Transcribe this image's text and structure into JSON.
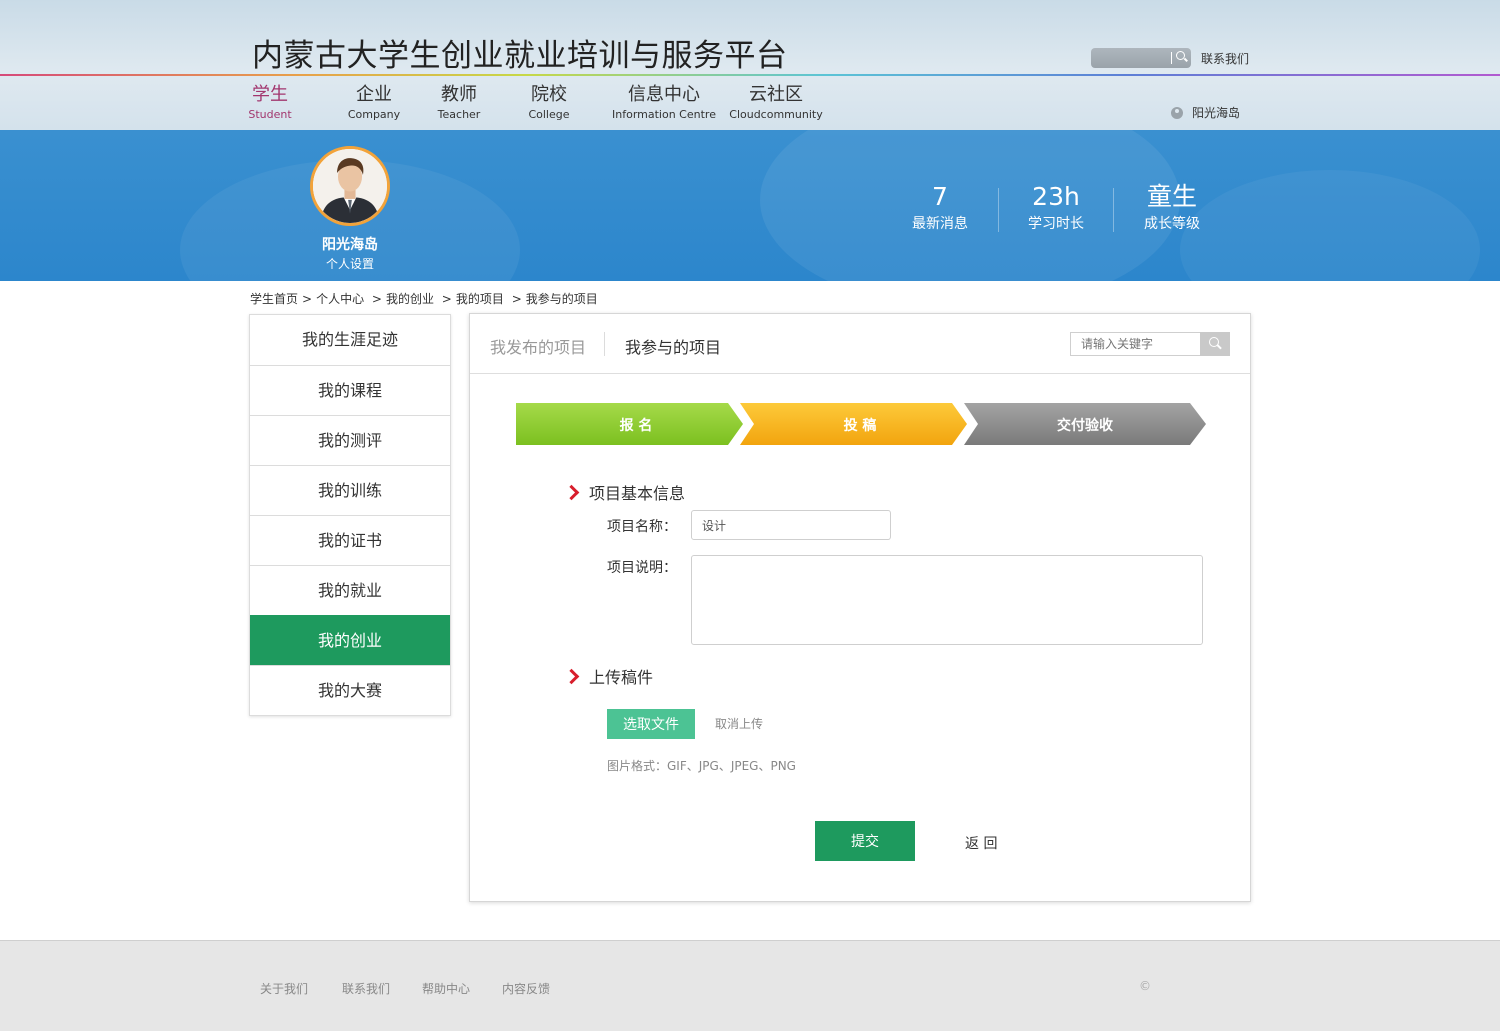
{
  "site": {
    "title": "内蒙古大学生创业就业培训与服务平台",
    "contact": "联系我们",
    "user": "阳光海岛"
  },
  "nav": [
    {
      "zh": "学生",
      "en": "Student",
      "active": true
    },
    {
      "zh": "企业",
      "en": "Company",
      "active": false
    },
    {
      "zh": "教师",
      "en": "Teacher",
      "active": false
    },
    {
      "zh": "院校",
      "en": "College",
      "active": false
    },
    {
      "zh": "信息中心",
      "en": "Information Centre",
      "active": false
    },
    {
      "zh": "云社区",
      "en": "Cloudcommunity",
      "active": false
    }
  ],
  "profile": {
    "name": "阳光海岛",
    "settings": "个人设置",
    "stats": [
      {
        "value": "7",
        "label": "最新消息"
      },
      {
        "value": "23h",
        "label": "学习时长"
      },
      {
        "value": "童生",
        "label": "成长等级"
      }
    ]
  },
  "breadcrumb": [
    "学生首页",
    "个人中心",
    "我的创业",
    "我的项目",
    "我参与的项目"
  ],
  "sidebar": [
    {
      "label": "我的生涯足迹",
      "active": false
    },
    {
      "label": "我的课程",
      "active": false
    },
    {
      "label": "我的测评",
      "active": false
    },
    {
      "label": "我的训练",
      "active": false
    },
    {
      "label": "我的证书",
      "active": false
    },
    {
      "label": "我的就业",
      "active": false
    },
    {
      "label": "我的创业",
      "active": true
    },
    {
      "label": "我的大赛",
      "active": false
    }
  ],
  "panel": {
    "tabs": [
      "我发布的项目",
      "我参与的项目"
    ],
    "active_tab": 1,
    "search_placeholder": "请输入关键字",
    "steps": [
      {
        "label": "报 名",
        "color": "#8ccc2e"
      },
      {
        "label": "投 稿",
        "color": "#f7b719"
      },
      {
        "label": "交付验收",
        "color": "#8d8d8d"
      }
    ],
    "section_info": "项目基本信息",
    "name_label": "项目名称：",
    "name_value": "设计",
    "desc_label": "项目说明：",
    "desc_value": "",
    "section_upload": "上传稿件",
    "choose_file": "选取文件",
    "cancel_upload": "取消上传",
    "formats": "图片格式：GIF、JPG、JPEG、PNG",
    "submit": "提交",
    "back": "返 回"
  },
  "footer": {
    "links": [
      "关于我们",
      "联系我们",
      "帮助中心",
      "内容反馈"
    ],
    "copyright": "©"
  },
  "colors": {
    "accent_green": "#1e9a5e",
    "nav_active": "#a2366e",
    "banner_blue": "#2c86cc",
    "file_button": "#4cc394"
  }
}
